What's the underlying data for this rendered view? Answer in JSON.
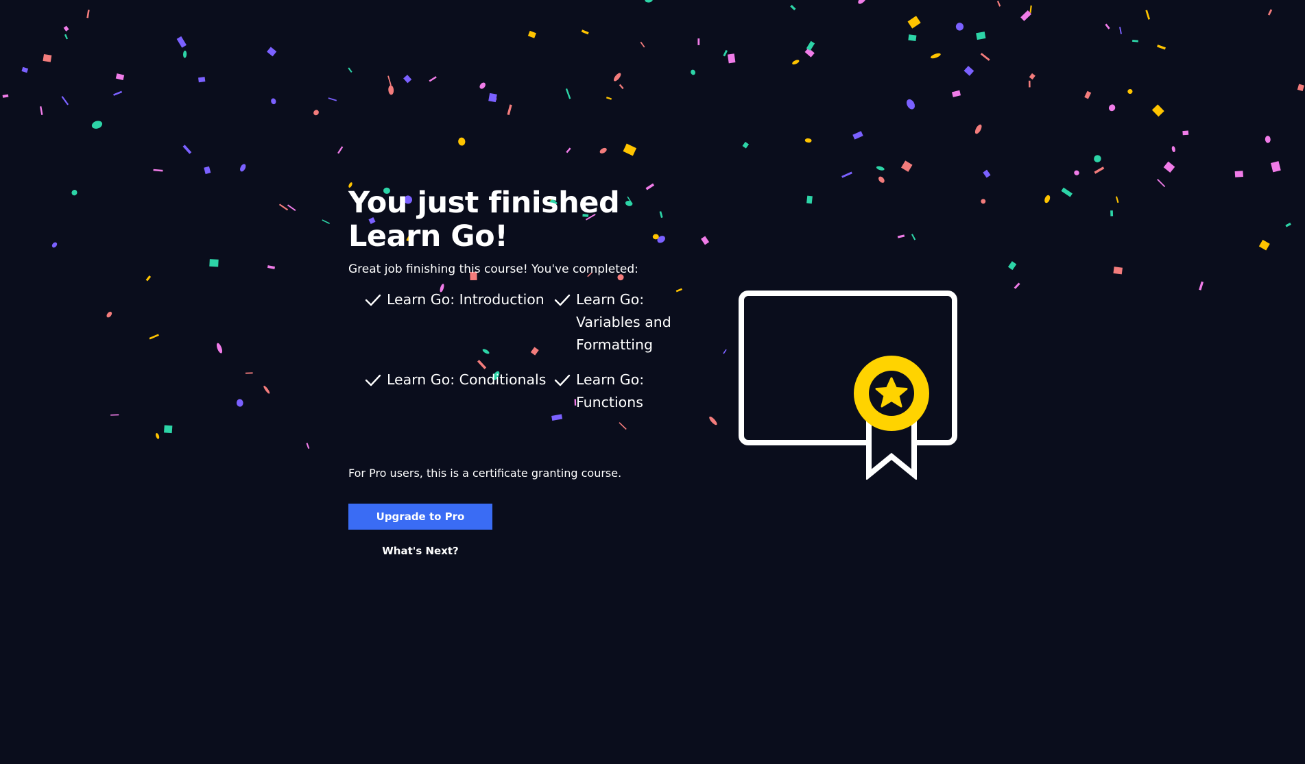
{
  "headline": {
    "line1": "You just finished",
    "line2": "Learn Go!"
  },
  "subtitle": "Great job finishing this course! You've completed:",
  "completed_courses": [
    {
      "label": "Learn Go: Introduction",
      "icon": "check-icon"
    },
    {
      "label": "Learn Go: Variables and Formatting",
      "icon": "check-icon"
    },
    {
      "label": "Learn Go: Conditionals",
      "icon": "check-icon"
    },
    {
      "label": "Learn Go: Functions",
      "icon": "check-icon"
    }
  ],
  "pro_note": "For Pro users, this is a certificate granting course.",
  "actions": {
    "upgrade_label": "Upgrade to Pro",
    "next_label": "What's Next?"
  },
  "illustration": {
    "icon": "certificate-icon",
    "badge_icon": "star-medal-icon"
  },
  "colors": {
    "background": "#0a0d1c",
    "accent_blue": "#3a6cf4",
    "medal_yellow": "#ffd300",
    "confetti": [
      "#f37c7c",
      "#2dd4a7",
      "#7b61ff",
      "#ffc400",
      "#f07ce8"
    ]
  }
}
